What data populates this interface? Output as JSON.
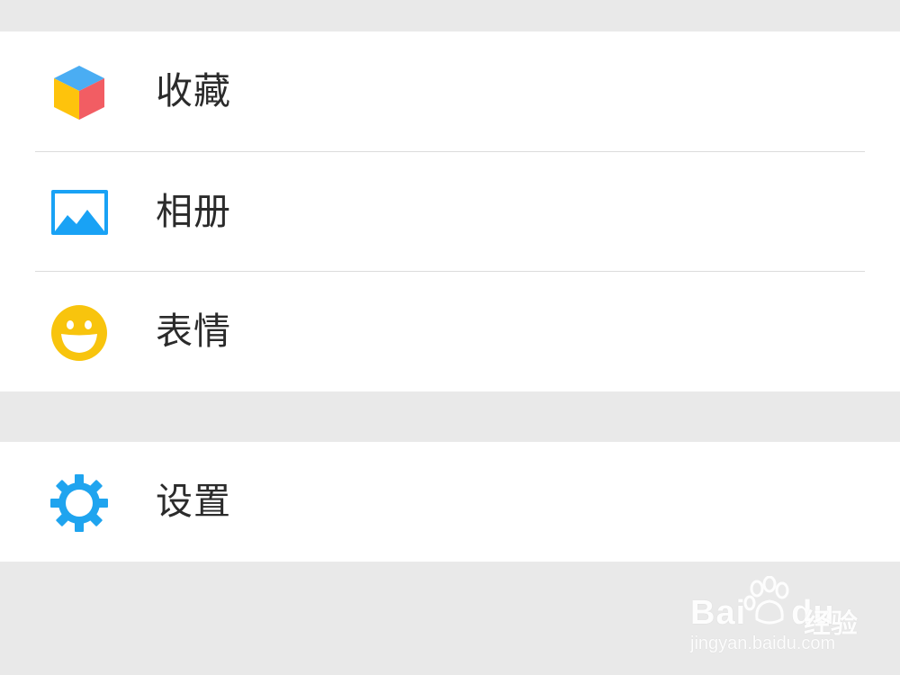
{
  "menu_group_1": {
    "items": [
      {
        "label": "收藏",
        "icon": "cube-icon",
        "icon_colors": [
          "#4AADF3",
          "#FEC30C",
          "#F25D63"
        ]
      },
      {
        "label": "相册",
        "icon": "picture-icon",
        "icon_colors": [
          "#19A2F5"
        ]
      },
      {
        "label": "表情",
        "icon": "smiley-icon",
        "icon_colors": [
          "#F8C40D"
        ]
      }
    ]
  },
  "menu_group_2": {
    "items": [
      {
        "label": "设置",
        "icon": "gear-icon",
        "icon_colors": [
          "#1FA4EF"
        ]
      }
    ]
  },
  "watermark": {
    "brand_prefix": "Bai",
    "brand_suffix": "du",
    "product": "经验",
    "url": "jingyan.baidu.com"
  },
  "colors": {
    "background": "#E9E9E9",
    "card": "#FFFFFF",
    "label_text": "#2B2B2B",
    "divider": "#DCDCDC"
  }
}
